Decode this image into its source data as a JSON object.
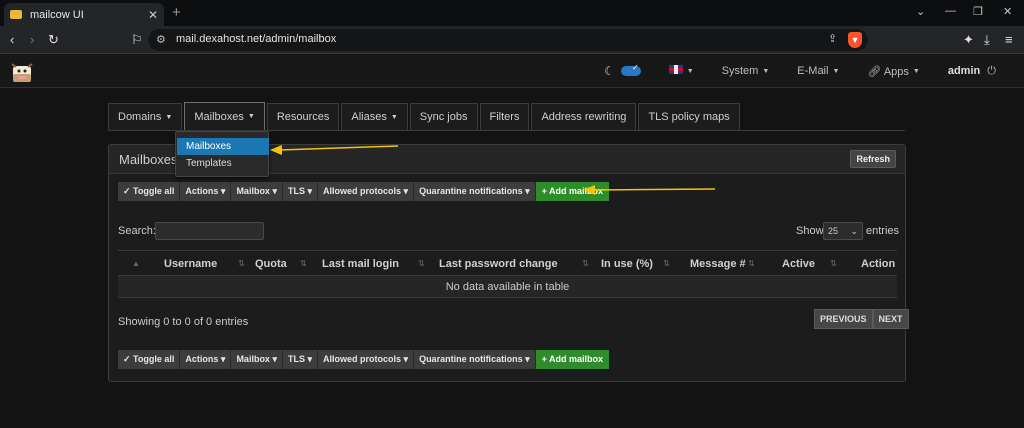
{
  "browser": {
    "tab_title": "mailcow UI",
    "url": "mail.dexahost.net/admin/mailbox"
  },
  "navbar": {
    "system": "System",
    "email": "E-Mail",
    "apps": "Apps",
    "user": "admin"
  },
  "tabs": [
    {
      "label": "Domains"
    },
    {
      "label": "Mailboxes"
    },
    {
      "label": "Resources"
    },
    {
      "label": "Aliases"
    },
    {
      "label": "Sync jobs"
    },
    {
      "label": "Filters"
    },
    {
      "label": "Address rewriting"
    },
    {
      "label": "TLS policy maps"
    }
  ],
  "dropdown": {
    "items": [
      "Mailboxes",
      "Templates"
    ]
  },
  "panel": {
    "title": "Mailboxes",
    "refresh": "Refresh"
  },
  "toolbar": {
    "toggle_all": "Toggle all",
    "actions": "Actions",
    "mailbox": "Mailbox",
    "tls": "TLS",
    "allowed_protocols": "Allowed protocols",
    "quarantine": "Quarantine notifications",
    "add_mailbox": "Add mailbox"
  },
  "table": {
    "search_label": "Search:",
    "show_label": "Show",
    "page_size": "25",
    "entries_label": "entries",
    "columns": [
      "Username",
      "Quota",
      "Last mail login",
      "Last password change",
      "In use (%)",
      "Message #",
      "Active",
      "Action"
    ],
    "empty": "No data available in table",
    "info": "Showing 0 to 0 of 0 entries",
    "prev": "PREVIOUS",
    "next": "NEXT"
  },
  "colors": {
    "accent": "#1b78b3",
    "add_button": "#2e8c2b",
    "annotation_arrow": "#f2c40f"
  }
}
